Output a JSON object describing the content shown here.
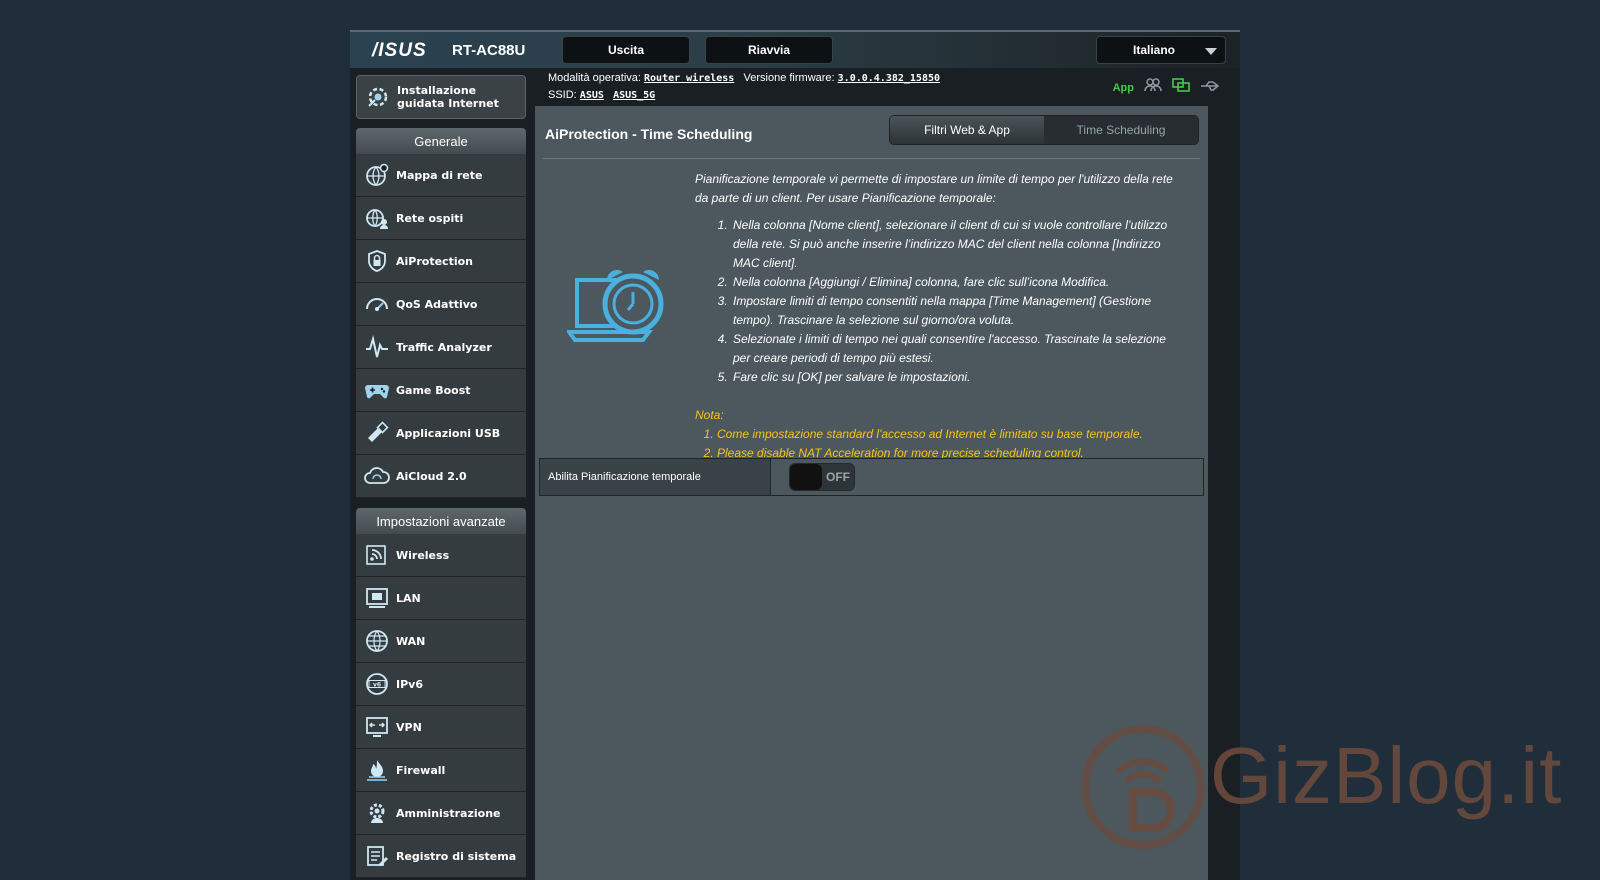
{
  "header": {
    "brand": "/ISUS",
    "model": "RT-AC88U",
    "exit_label": "Uscita",
    "reboot_label": "Riavvia",
    "language": "Italiano"
  },
  "status": {
    "mode_label": "Modalità operativa:",
    "mode_value": "Router wireless",
    "fw_label": "Versione firmware:",
    "fw_value": "3.0.0.4.382_15850",
    "ssid_label": "SSID:",
    "ssid_1": "ASUS",
    "ssid_2": "ASUS_5G",
    "app_label": "App"
  },
  "sidebar": {
    "quick_setup": "Installazione guidata Internet",
    "general_title": "Generale",
    "general_items": [
      {
        "label": "Mappa di rete",
        "icon": "network-map-icon"
      },
      {
        "label": "Rete ospiti",
        "icon": "guest-network-icon"
      },
      {
        "label": "AiProtection",
        "icon": "shield-lock-icon"
      },
      {
        "label": "QoS Adattivo",
        "icon": "speedometer-icon"
      },
      {
        "label": "Traffic Analyzer",
        "icon": "traffic-wave-icon"
      },
      {
        "label": "Game Boost",
        "icon": "gamepad-icon"
      },
      {
        "label": "Applicazioni USB",
        "icon": "usb-app-icon"
      },
      {
        "label": "AiCloud 2.0",
        "icon": "cloud-icon"
      }
    ],
    "advanced_title": "Impostazioni avanzate",
    "advanced_items": [
      {
        "label": "Wireless",
        "icon": "wireless-icon"
      },
      {
        "label": "LAN",
        "icon": "lan-icon"
      },
      {
        "label": "WAN",
        "icon": "globe-icon"
      },
      {
        "label": "IPv6",
        "icon": "ipv6-icon"
      },
      {
        "label": "VPN",
        "icon": "vpn-icon"
      },
      {
        "label": "Firewall",
        "icon": "firewall-icon"
      },
      {
        "label": "Amministrazione",
        "icon": "gear-admin-icon"
      },
      {
        "label": "Registro di sistema",
        "icon": "log-icon"
      }
    ]
  },
  "main": {
    "title": "AiProtection - Time Scheduling",
    "tabs": [
      {
        "label": "Filtri Web & App",
        "active": false
      },
      {
        "label": "Time Scheduling",
        "active": true
      }
    ],
    "intro": "Pianificazione temporale vi permette di impostare un limite di tempo per l'utilizzo della rete da parte di un client. Per usare Pianificazione temporale:",
    "steps": [
      "Nella colonna [Nome client], selezionare il client di cui si vuole controllare l’utilizzo della rete. Si può anche inserire l’indirizzo MAC del client nella colonna [Indirizzo MAC client].",
      "Nella colonna [Aggiungi / Elimina] colonna, fare clic sull’icona Modifica.",
      "Impostare limiti di tempo consentiti nella mappa [Time Management] (Gestione tempo). Trascinare la selezione sul giorno/ora voluta.",
      "Selezionate i limiti di tempo nei quali consentire l'accesso. Trascinate la selezione per creare periodi di tempo più estesi.",
      "Fare clic su [OK] per salvare le impostazioni."
    ],
    "note_title": "Nota:",
    "note_1": "Come impostazione standard l'accesso ad Internet è limitato su base temporale.",
    "note_2_pre": "Please disable ",
    "note_2_link": "NAT Acceleration",
    "note_2_post": " for more precise scheduling control.",
    "enable_label": "Abilita Pianificazione temporale",
    "toggle_state": "OFF"
  },
  "watermark": {
    "text": "GizBlog.it"
  },
  "colors": {
    "accent_link": "#f5c518",
    "app_green": "#47c94a",
    "panel": "#4c585d"
  }
}
